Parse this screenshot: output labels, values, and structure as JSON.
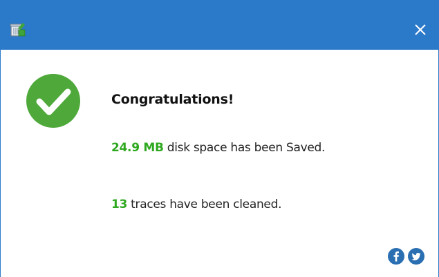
{
  "window": {
    "close_label": "×"
  },
  "result": {
    "title": "Congratulations!",
    "saved_value": "24.9 MB",
    "saved_text": " disk space has been Saved.",
    "traces_value": "13",
    "traces_text": " traces have been cleaned."
  },
  "social": {
    "items": [
      {
        "icon": "facebook-icon",
        "color": "#2a6fb2"
      },
      {
        "icon": "twitter-icon",
        "color": "#2a6fb2"
      }
    ]
  },
  "colors": {
    "titlebar": "#2b79c9",
    "success_green": "#4fa93a",
    "value_green": "#2ea81f"
  }
}
